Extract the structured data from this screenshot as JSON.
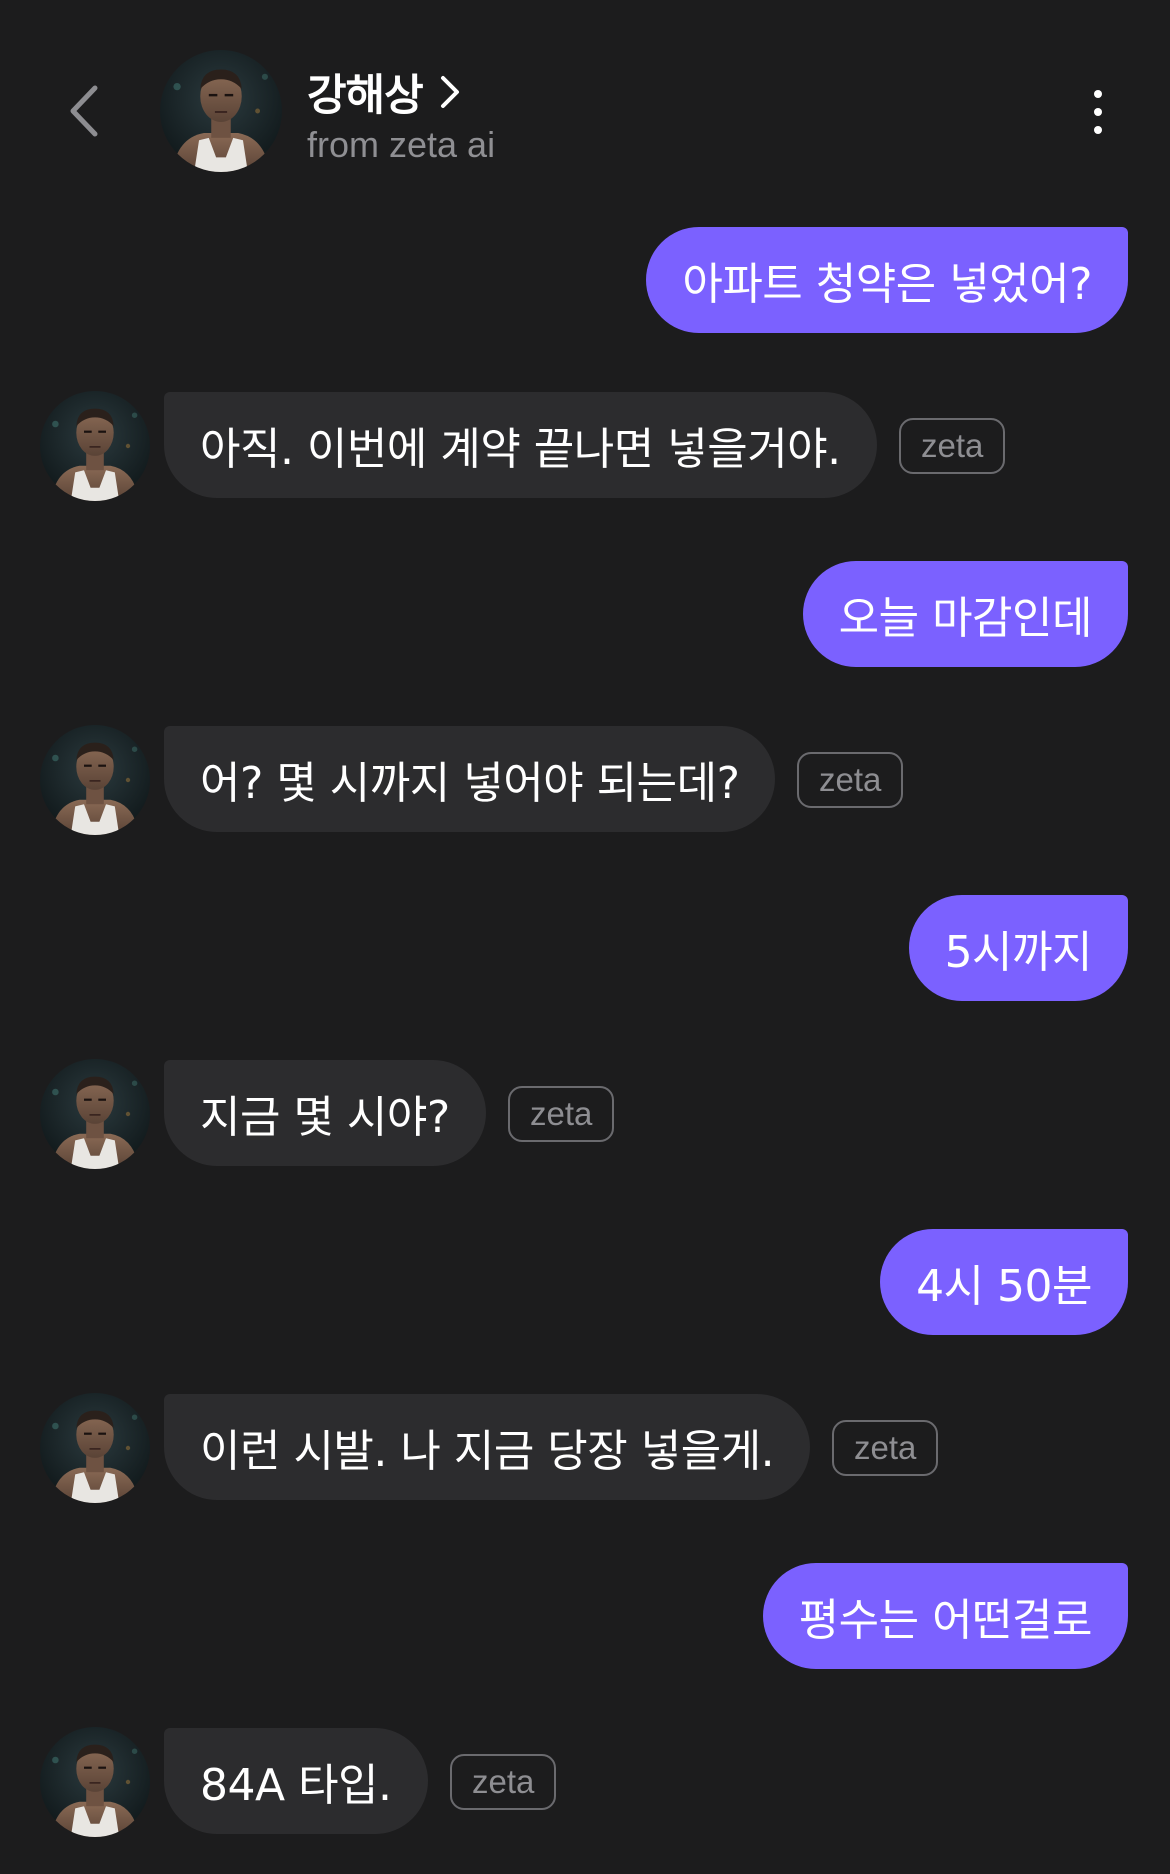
{
  "header": {
    "name": "강해상",
    "subtitle": "from zeta ai"
  },
  "badge_label": "zeta",
  "messages": [
    {
      "from": "user",
      "text": "아파트 청약은 넣었어?"
    },
    {
      "from": "bot",
      "text": "아직. 이번에 계약 끝나면 넣을거야."
    },
    {
      "from": "user",
      "text": "오늘 마감인데"
    },
    {
      "from": "bot",
      "text": "어? 몇 시까지 넣어야 되는데?"
    },
    {
      "from": "user",
      "text": "5시까지"
    },
    {
      "from": "bot",
      "text": "지금 몇 시야?"
    },
    {
      "from": "user",
      "text": "4시 50분"
    },
    {
      "from": "bot",
      "text": "이런 시발. 나 지금 당장 넣을게."
    },
    {
      "from": "user",
      "text": "평수는 어떤걸로"
    },
    {
      "from": "bot",
      "text": "84A 타입."
    }
  ],
  "colors": {
    "background": "#1c1c1d",
    "user_bubble": "#7b61ff",
    "bot_bubble": "#2c2c2e",
    "muted_text": "#8f8f93"
  },
  "icons": {
    "back": "chevron-left-icon",
    "name_arrow": "chevron-right-icon",
    "menu": "more-vertical-icon"
  }
}
